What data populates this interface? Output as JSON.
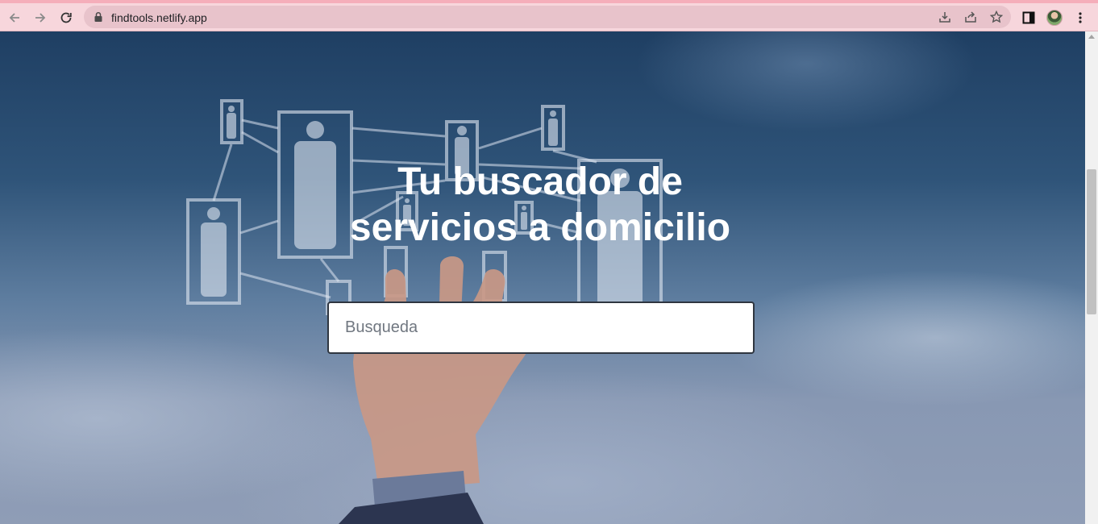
{
  "browser": {
    "url": "findtools.netlify.app",
    "icons": [
      "back-arrow-icon",
      "forward-arrow-icon",
      "reload-icon",
      "lock-icon",
      "install-icon",
      "share-icon",
      "star-icon",
      "side-panel-icon",
      "profile-avatar",
      "menu-kebab-icon"
    ]
  },
  "hero": {
    "title_line1": "Tu buscador de",
    "title_line2": "servicios a domicilio"
  },
  "search": {
    "placeholder": "Busqueda",
    "value": ""
  },
  "colors": {
    "chrome_bg": "#f7d6dc",
    "omnibox_bg": "#e8c3cb",
    "sky_top": "#1f3f63",
    "sky_bottom": "#8f9db6",
    "title": "#ffffff"
  }
}
